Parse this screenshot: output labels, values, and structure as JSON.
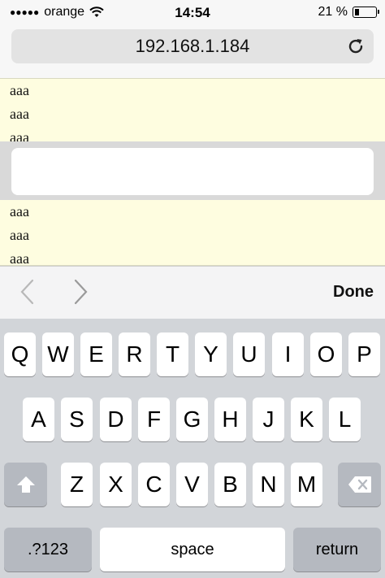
{
  "status": {
    "carrier": "orange",
    "time": "14:54",
    "battery": "21 %",
    "battery_level": 0.21
  },
  "address_bar": {
    "url": "192.168.1.184"
  },
  "page": {
    "top_rows": [
      "aaa",
      "aaa",
      "aaa"
    ],
    "bottom_rows": [
      "aaa",
      "aaa",
      "aaa"
    ],
    "input_value": ""
  },
  "accessory": {
    "done_label": "Done"
  },
  "keyboard": {
    "row1": [
      "Q",
      "W",
      "E",
      "R",
      "T",
      "Y",
      "U",
      "I",
      "O",
      "P"
    ],
    "row2": [
      "A",
      "S",
      "D",
      "F",
      "G",
      "H",
      "J",
      "K",
      "L"
    ],
    "row3": [
      "Z",
      "X",
      "C",
      "V",
      "B",
      "N",
      "M"
    ],
    "numbers_label": ".?123",
    "space_label": "space",
    "return_label": "return"
  }
}
